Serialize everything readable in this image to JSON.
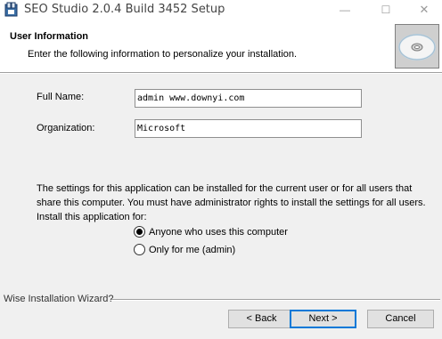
{
  "window": {
    "title": "SEO Studio 2.0.4 Build 3452 Setup",
    "minimize": "—",
    "maximize": "☐",
    "close": "✕"
  },
  "header": {
    "title": "User Information",
    "description": "Enter the following information to personalize your installation."
  },
  "form": {
    "full_name_label": "Full Name:",
    "full_name_value": "admin www.downyi.com",
    "organization_label": "Organization:",
    "organization_value": "Microsoft"
  },
  "install_scope": {
    "description": "The settings for this application can be installed for the current user or for all users that share this computer. You must have administrator rights to install the settings for all users. Install this application for:",
    "options": [
      {
        "label": "Anyone who uses this computer",
        "selected": true
      },
      {
        "label": "Only for me (admin)",
        "selected": false
      }
    ]
  },
  "footer": {
    "wizard_label": "Wise Installation Wizard?",
    "back_label": "< Back",
    "next_label": "Next >",
    "cancel_label": "Cancel"
  },
  "colors": {
    "dialog_bg": "#f0f0f0",
    "header_bg": "#ffffff",
    "default_button_border": "#0078d7"
  }
}
